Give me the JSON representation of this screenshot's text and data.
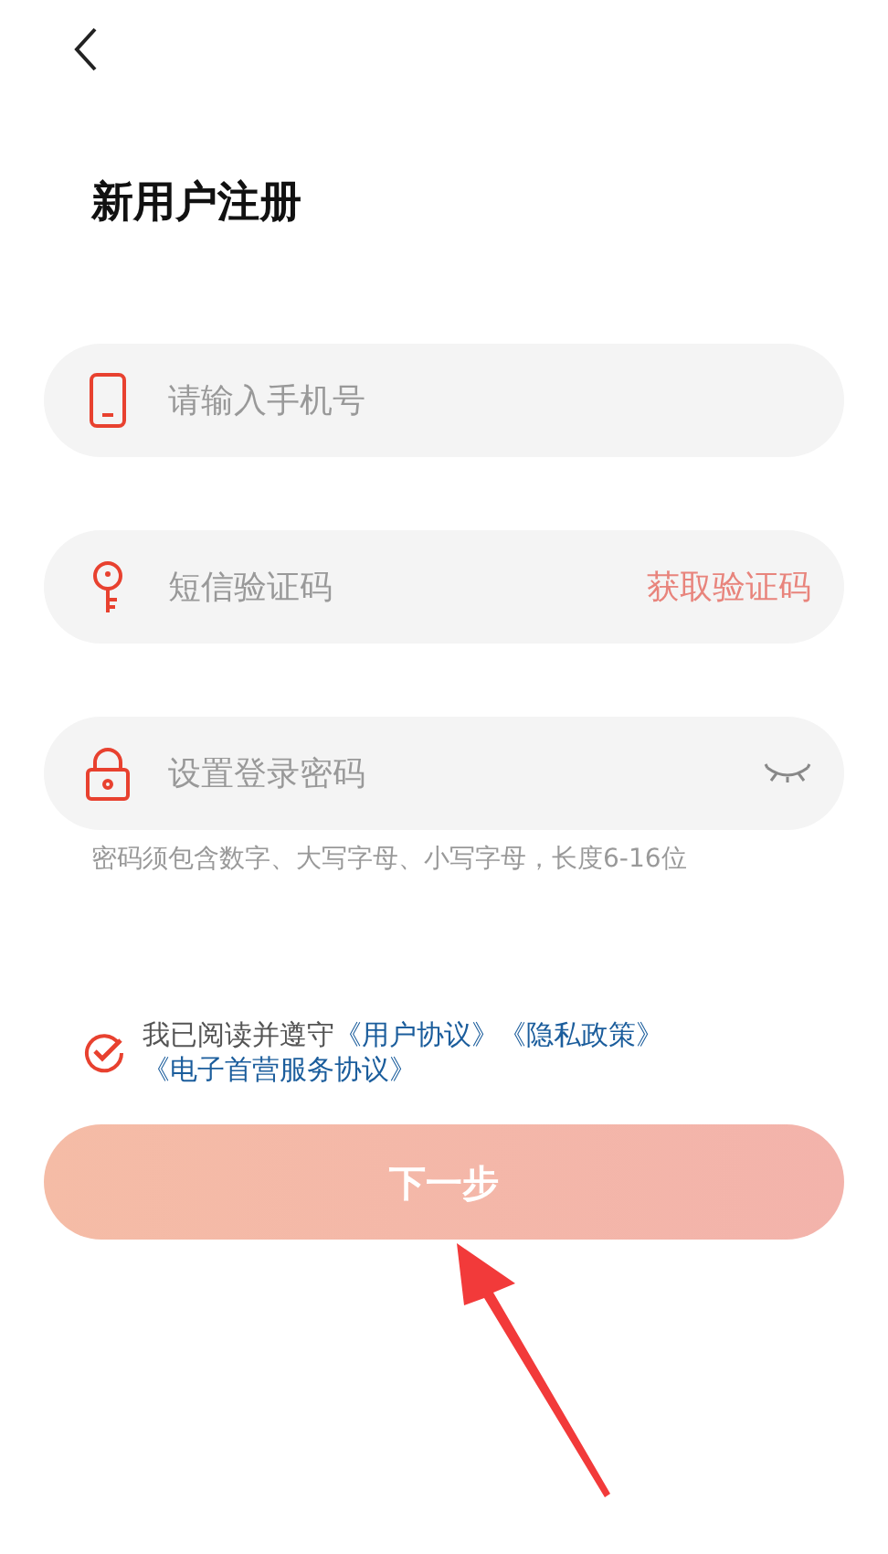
{
  "title": "新用户注册",
  "fields": [
    {
      "kind": "phone",
      "placeholder": "请输入手机号"
    },
    {
      "kind": "code",
      "placeholder": "短信验证码",
      "action": "获取验证码"
    },
    {
      "kind": "password",
      "placeholder": "设置登录密码"
    }
  ],
  "password_hint": "密码须包含数字、大写字母、小写字母，长度6-16位",
  "agreement": {
    "checked": true,
    "text": "我已阅读并遵守",
    "links": [
      "《用户协议》",
      "《隐私政策》",
      "《电子首营服务协议》"
    ]
  },
  "next_button": {
    "label": "下一步"
  }
}
